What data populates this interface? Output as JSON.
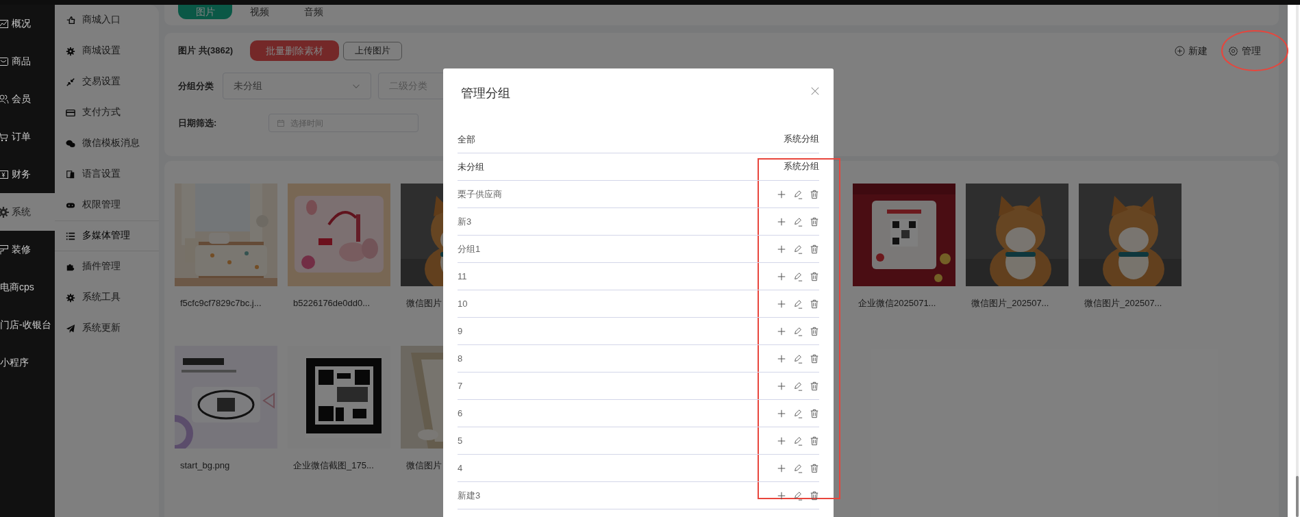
{
  "nav": [
    {
      "label": "概况",
      "selected": false
    },
    {
      "label": "商品",
      "selected": false
    },
    {
      "label": "会员",
      "selected": false
    },
    {
      "label": "订单",
      "selected": false
    },
    {
      "label": "财务",
      "selected": false
    },
    {
      "label": "系统",
      "selected": true
    },
    {
      "label": "装修",
      "selected": false
    },
    {
      "label": "电商cps",
      "selected": false
    },
    {
      "label": "门店-收银台",
      "selected": false
    },
    {
      "label": "小程序",
      "selected": false
    }
  ],
  "submenu": [
    {
      "label": "商城入口",
      "selected": false
    },
    {
      "label": "商城设置",
      "selected": false
    },
    {
      "label": "交易设置",
      "selected": false
    },
    {
      "label": "支付方式",
      "selected": false
    },
    {
      "label": "微信模板消息",
      "selected": false
    },
    {
      "label": "语言设置",
      "selected": false
    },
    {
      "label": "权限管理",
      "selected": false
    },
    {
      "label": "多媒体管理",
      "selected": true
    },
    {
      "label": "插件管理",
      "selected": false
    },
    {
      "label": "系统工具",
      "selected": false
    },
    {
      "label": "系统更新",
      "selected": false
    }
  ],
  "media_tabs": [
    {
      "label": "图片",
      "selected": true
    },
    {
      "label": "视频",
      "selected": false
    },
    {
      "label": "音频",
      "selected": false
    }
  ],
  "toolbar": {
    "count_label": "图片 共(3862)",
    "batch_delete": "批量删除素材",
    "upload": "上传图片",
    "new": "新建",
    "manage": "管理"
  },
  "filters": {
    "group_label": "分组分类",
    "group_value": "未分组",
    "subgroup_placeholder": "二级分类",
    "date_label": "日期筛选:",
    "date_placeholder": "选择时间"
  },
  "media_rows": [
    {
      "left": [
        {
          "caption": "f5cfc9cf7829c7bc.j...",
          "kind": "picture"
        },
        {
          "caption": "b5226176de0dd0...",
          "kind": "picture"
        },
        {
          "caption": "微信图片",
          "kind": "picture"
        }
      ],
      "right": [
        {
          "caption": "企业微信2025071...",
          "kind": "picture"
        },
        {
          "caption": "微信图片_202507...",
          "kind": "picture"
        },
        {
          "caption": "微信图片_202507...",
          "kind": "picture"
        }
      ]
    },
    {
      "left": [
        {
          "caption": "start_bg.png",
          "kind": "picture"
        },
        {
          "caption": "企业微信截图_175...",
          "kind": "picture"
        },
        {
          "caption": "微信图片",
          "kind": "picture"
        }
      ]
    }
  ],
  "modal": {
    "title": "管理分组",
    "groups": [
      {
        "name": "全部",
        "kind": "system",
        "tag": "系统分组"
      },
      {
        "name": "未分组",
        "kind": "system",
        "tag": "系统分组"
      },
      {
        "name": "栗子供应商",
        "kind": "custom"
      },
      {
        "name": "新3",
        "kind": "custom"
      },
      {
        "name": "分组1",
        "kind": "custom"
      },
      {
        "name": "11",
        "kind": "custom"
      },
      {
        "name": "10",
        "kind": "custom"
      },
      {
        "name": "9",
        "kind": "custom"
      },
      {
        "name": "8",
        "kind": "custom"
      },
      {
        "name": "7",
        "kind": "custom"
      },
      {
        "name": "6",
        "kind": "custom"
      },
      {
        "name": "5",
        "kind": "custom"
      },
      {
        "name": "4",
        "kind": "custom"
      },
      {
        "name": "新建3",
        "kind": "custom"
      }
    ]
  }
}
